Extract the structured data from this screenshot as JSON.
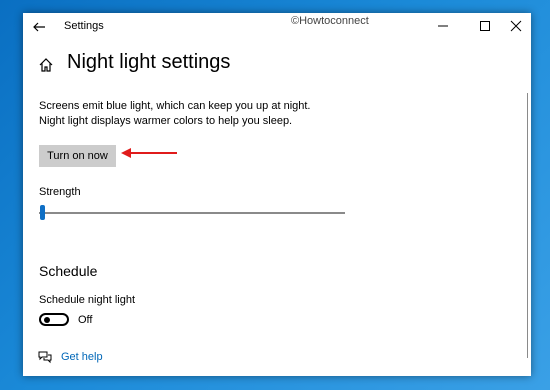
{
  "titlebar": {
    "title": "Settings",
    "watermark": "©Howtoconnect"
  },
  "icons": {
    "back": "back-arrow-icon",
    "home": "home-icon",
    "minimize": "minimize-icon",
    "maximize": "maximize-icon",
    "close": "close-icon",
    "help": "chat-help-icon"
  },
  "page": {
    "title": "Night light settings",
    "description": "Screens emit blue light, which can keep you up at night. Night light displays warmer colors to help you sleep.",
    "turn_on_label": "Turn on now"
  },
  "strength": {
    "label": "Strength",
    "value": 0
  },
  "schedule": {
    "heading": "Schedule",
    "label": "Schedule night light",
    "state": "Off"
  },
  "help": {
    "label": "Get help"
  },
  "colors": {
    "accent": "#0f6fc5",
    "link": "#0067b8",
    "annotation_arrow": "#e01b1b",
    "button_bg": "#cccccc"
  }
}
